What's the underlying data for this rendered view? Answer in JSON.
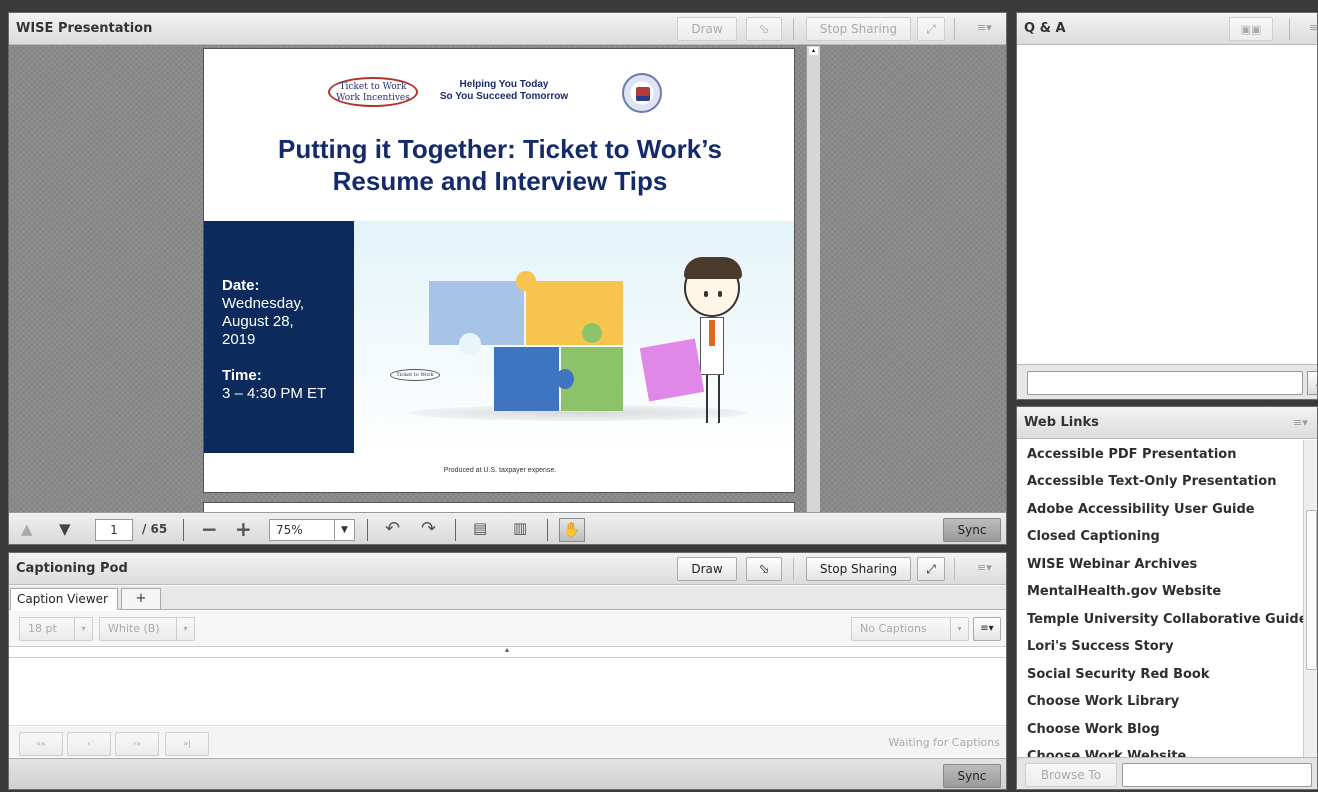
{
  "presentation": {
    "title": "WISE Presentation",
    "draw_label": "Draw",
    "stop_sharing_label": "Stop Sharing",
    "slide": {
      "logo_ticket_line1": "Ticket to Work",
      "logo_ticket_line2": "Work Incentives",
      "tagline_line1": "Helping You Today",
      "tagline_line2": "So You Succeed Tomorrow",
      "heading_line1": "Putting it Together: Ticket to Work’s",
      "heading_line2": "Resume and Interview Tips",
      "date_label": "Date:",
      "date_line1": "Wednesday,",
      "date_line2": "August 28,",
      "date_line3": "2019",
      "time_label": "Time:",
      "time_value": "3 – 4:30 PM ET",
      "small_logo": "Ticket to Work",
      "footer": "Produced at U.S. taxpayer expense."
    },
    "toolbar": {
      "page": "1",
      "total_pages": "/ 65",
      "zoom": "75%",
      "sync_label": "Sync"
    }
  },
  "captioning": {
    "title": "Captioning Pod",
    "draw_label": "Draw",
    "stop_sharing_label": "Stop Sharing",
    "tab_label": "Caption Viewer",
    "add_tab": "+",
    "font_size": "18 pt",
    "color": "White (B)",
    "no_captions": "No Captions",
    "status": "Waiting for Captions",
    "sync_label": "Sync",
    "nav": [
      "««",
      "‹",
      "›»",
      "»|"
    ]
  },
  "qa": {
    "title": "Q & A"
  },
  "weblinks": {
    "title": "Web Links",
    "items": [
      "Accessible PDF Presentation",
      "Accessible Text-Only Presentation",
      "Adobe Accessibility User Guide",
      "Closed Captioning",
      "WISE Webinar Archives",
      "MentalHealth.gov Website",
      "Temple University Collaborative Guide",
      "Lori's Success Story",
      "Social Security Red Book",
      "Choose Work Library",
      "Choose Work Blog",
      "Choose Work Website"
    ],
    "browse_label": "Browse To"
  },
  "colors": {
    "slide_navy": "#0d2a5c",
    "heading_navy": "#142a6b",
    "puzzle_blue_light": "#a7c4e6",
    "puzzle_yellow": "#f7c44e",
    "puzzle_blue": "#3f74bf",
    "puzzle_green": "#8cc36a",
    "puzzle_pink": "#e088e8"
  }
}
